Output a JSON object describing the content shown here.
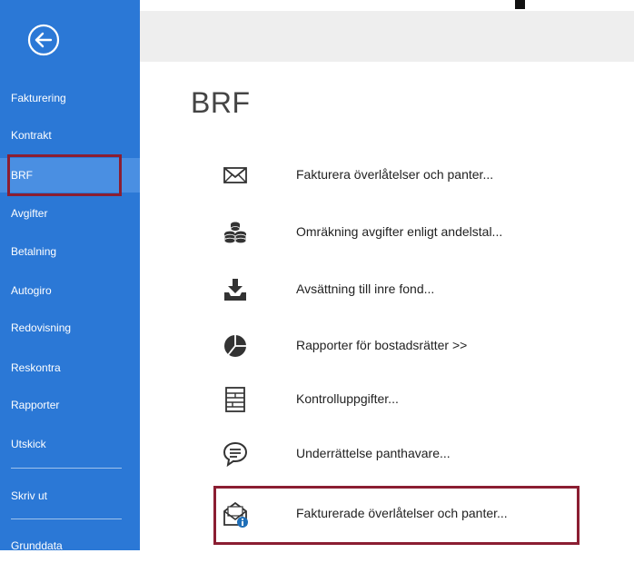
{
  "sidebar": {
    "items": [
      {
        "label": "Fakturering"
      },
      {
        "label": "Kontrakt"
      },
      {
        "label": "BRF",
        "selected": true
      },
      {
        "label": "Avgifter"
      },
      {
        "label": "Betalning"
      },
      {
        "label": "Autogiro"
      },
      {
        "label": "Redovisning"
      },
      {
        "label": "Reskontra"
      },
      {
        "label": "Rapporter"
      },
      {
        "label": "Utskick"
      },
      {
        "label": "Skriv ut"
      },
      {
        "label": "Grunddata"
      }
    ]
  },
  "main": {
    "title": "BRF",
    "actions": [
      {
        "label": "Fakturera överlåtelser och panter...",
        "icon": "envelope-icon"
      },
      {
        "label": "Omräkning avgifter enligt andelstal...",
        "icon": "coins-icon"
      },
      {
        "label": "Avsättning till inre fond...",
        "icon": "download-tray-icon"
      },
      {
        "label": "Rapporter för bostadsrätter >>",
        "icon": "pie-chart-icon"
      },
      {
        "label": "Kontrolluppgifter...",
        "icon": "form-icon"
      },
      {
        "label": "Underrättelse panthavare...",
        "icon": "speech-bubble-icon"
      },
      {
        "label": "Fakturerade överlåtelser och panter...",
        "icon": "open-envelope-info-icon",
        "highlighted": true
      }
    ]
  },
  "colors": {
    "sidebar": "#2b78d6",
    "sidebar_selected": "#4a8fe2",
    "highlight_border": "#8b1e32",
    "info_badge": "#1f6fb8"
  }
}
